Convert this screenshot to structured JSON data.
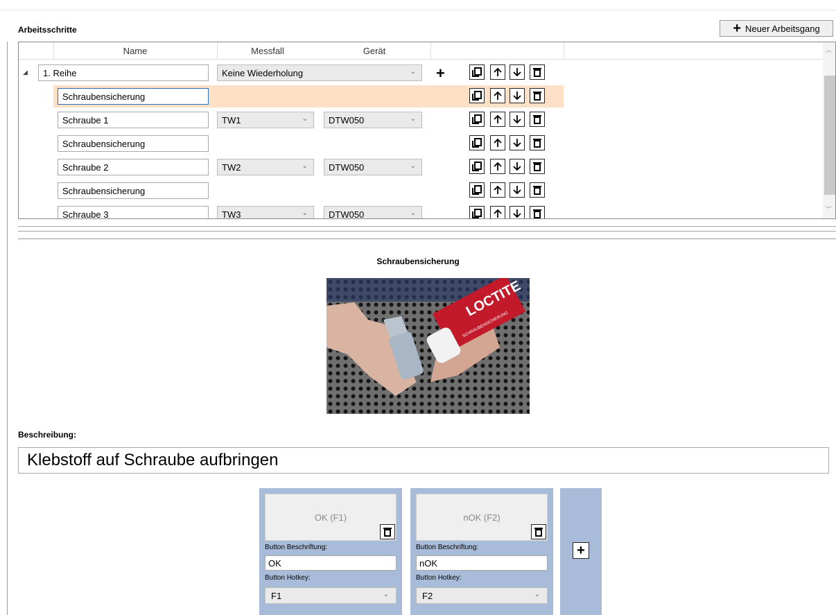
{
  "section": {
    "title": "Arbeitsschritte",
    "new_button": "Neuer Arbeitsgang"
  },
  "grid": {
    "columns": [
      "Name",
      "Messfall",
      "Gerät"
    ],
    "group": {
      "name": "1. Reihe",
      "messfall": "Keine Wiederholung"
    },
    "rows": [
      {
        "name": "Schraubensicherung",
        "messfall": "",
        "geraet": "",
        "selected": true
      },
      {
        "name": "Schraube 1",
        "messfall": "TW1",
        "geraet": "DTW050"
      },
      {
        "name": "Schraubensicherung",
        "messfall": "",
        "geraet": ""
      },
      {
        "name": "Schraube 2",
        "messfall": "TW2",
        "geraet": "DTW050"
      },
      {
        "name": "Schraubensicherung",
        "messfall": "",
        "geraet": ""
      },
      {
        "name": "Schraube 3",
        "messfall": "TW3",
        "geraet": "DTW050"
      }
    ]
  },
  "detail": {
    "title": "Schraubensicherung",
    "image_label": "LOCTITE",
    "image_label2": "SCHRAUBENSICHERUNG",
    "description_label": "Beschreibung:",
    "description": "Klebstoff auf Schraube aufbringen"
  },
  "buttons": [
    {
      "face": "OK (F1)",
      "caption_label": "Button Beschriftung:",
      "caption": "OK",
      "hotkey_label": "Button Hotkey:",
      "hotkey": "F1"
    },
    {
      "face": "nOK (F2)",
      "caption_label": "Button Beschriftung:",
      "caption": "nOK",
      "hotkey_label": "Button Hotkey:",
      "hotkey": "F2"
    }
  ],
  "colors": {
    "selected_row": "#fde0c6",
    "card_bg": "#a8bcd9",
    "focus_border": "#2a6ebb"
  }
}
